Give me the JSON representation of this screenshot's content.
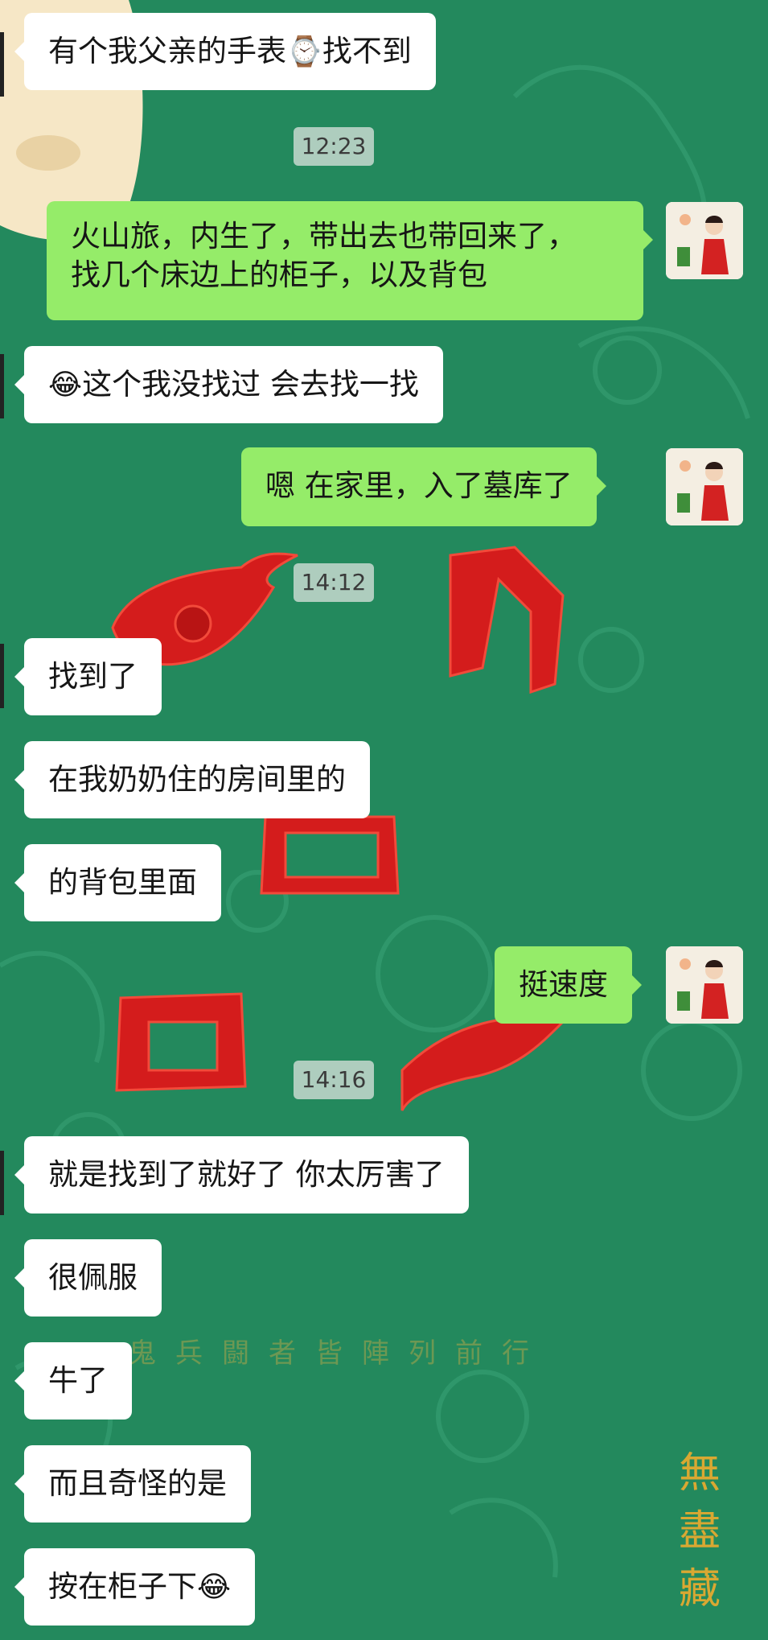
{
  "background": {
    "base_color": "#23895d",
    "watermark_text": "鬼兵闘者皆陣列前行",
    "signature_text": "無盡藏"
  },
  "timestamps": {
    "t1": "12:23",
    "t2": "14:12",
    "t3": "14:16"
  },
  "messages": [
    {
      "side": "left",
      "text": "有个我父亲的手表",
      "tail": "找不到",
      "icon": "watch-icon"
    },
    {
      "side": "right",
      "line1": "火山旅，内生了，带出去也带回来了，",
      "line2": "找几个床边上的柜子，以及背包"
    },
    {
      "side": "left",
      "text": "这个我没找过  会去找一找",
      "icon": "crying-laughing-emoji"
    },
    {
      "side": "right",
      "text": "嗯  在家里，入了墓库了"
    },
    {
      "side": "left",
      "text": "找到了"
    },
    {
      "side": "left",
      "text": "在我奶奶住的房间里的"
    },
    {
      "side": "left",
      "text": "的背包里面"
    },
    {
      "side": "right",
      "text": "挺速度"
    },
    {
      "side": "left",
      "text": "就是找到了就好了  你太厉害了"
    },
    {
      "side": "left",
      "text": "很佩服"
    },
    {
      "side": "left",
      "text": "牛了"
    },
    {
      "side": "left",
      "text": "而且奇怪的是"
    },
    {
      "side": "left",
      "text": "按在柜子下",
      "icon": "crying-laughing-emoji"
    }
  ],
  "colors": {
    "left_bubble": "#ffffff",
    "right_bubble": "#95ec69",
    "text": "#161616"
  }
}
